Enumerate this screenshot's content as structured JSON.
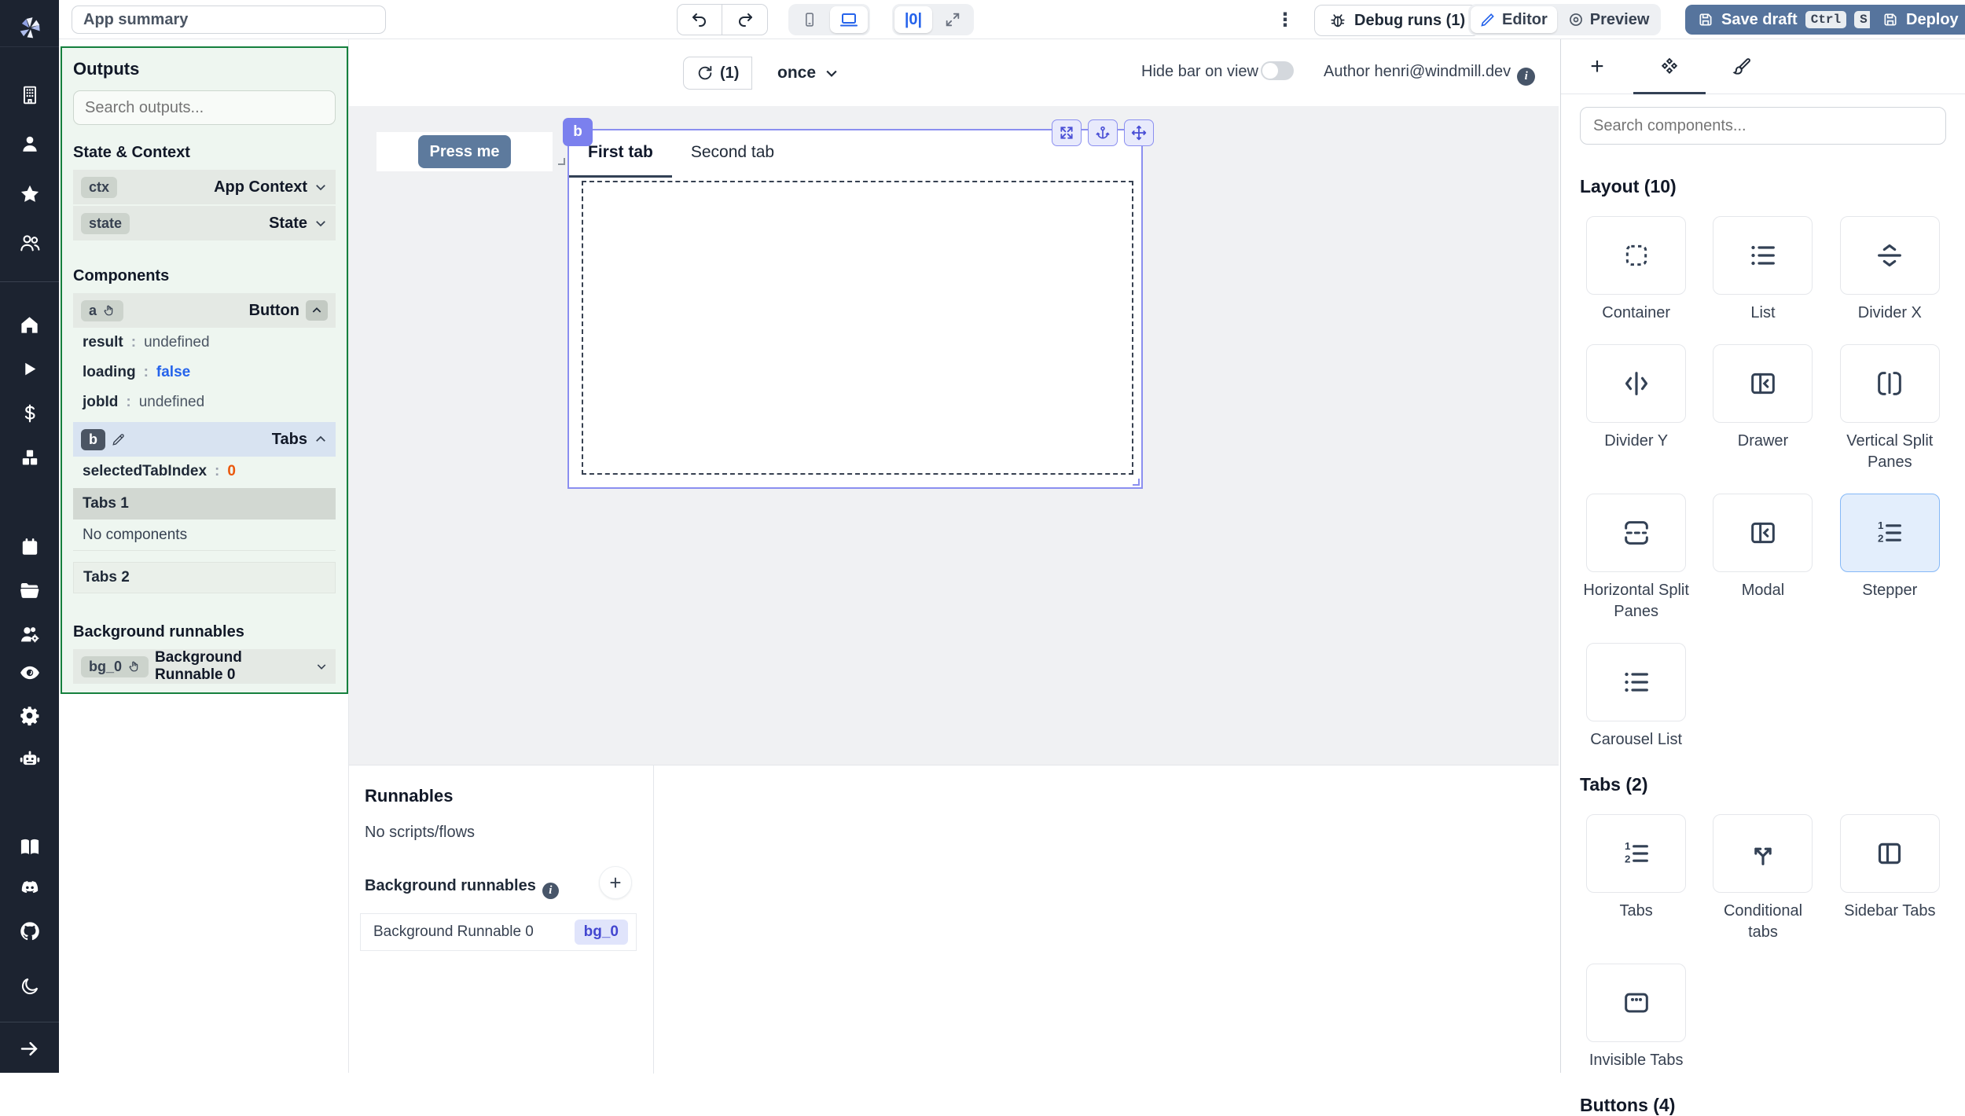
{
  "colors": {
    "sidebar_bg": "#1c2330",
    "primary_button_blue": "#56749d",
    "canvas_button_blue": "#5d7a9d",
    "selection_indigo": "#7b80ee",
    "outputs_border_green": "#15803d",
    "selected_card_bg": "#e3eefc",
    "link_blue": "#2563eb",
    "value_orange": "#ea580c"
  },
  "sidebar": {
    "icons": [
      "windmill-logo",
      "workspace-building",
      "user",
      "favorites-star",
      "groups",
      "home",
      "runs-play",
      "billing-dollar",
      "resources-boxes",
      "schedules-calendar",
      "folders",
      "workers-admin",
      "audit-eye",
      "settings-gear",
      "ai-bot",
      "docs-book",
      "discord",
      "github",
      "dark-mode-moon",
      "collapse-arrow"
    ]
  },
  "topbar": {
    "app_summary": "App summary",
    "debug_runs": "Debug runs (1)",
    "editor": "Editor",
    "preview": "Preview",
    "save_draft": "Save draft",
    "kbd_ctrl": "Ctrl",
    "kbd_s": "S",
    "deploy": "Deploy"
  },
  "outputs": {
    "title": "Outputs",
    "search_placeholder": "Search outputs...",
    "state_context": {
      "title": "State & Context",
      "rows": [
        {
          "id": "ctx",
          "type": "App Context"
        },
        {
          "id": "state",
          "type": "State"
        }
      ]
    },
    "components": {
      "title": "Components",
      "a": {
        "id": "a",
        "type": "Button",
        "props": [
          {
            "key": "result",
            "colon": ":",
            "value": "undefined"
          },
          {
            "key": "loading",
            "colon": ":",
            "value": "false"
          },
          {
            "key": "jobId",
            "colon": ":",
            "value": "undefined"
          }
        ]
      },
      "b": {
        "id": "b",
        "type": "Tabs",
        "props": [
          {
            "key": "selectedTabIndex",
            "colon": ":",
            "value": "0"
          }
        ]
      },
      "tabs1_label": "Tabs 1",
      "tabs1_empty": "No components",
      "tabs2_label": "Tabs 2"
    },
    "background": {
      "title": "Background runnables",
      "row": {
        "id": "bg_0",
        "label": "Background Runnable 0"
      }
    }
  },
  "canvas": {
    "refresh_count": "(1)",
    "schedule": "once",
    "hide_bar_label": "Hide bar on view",
    "author": "Author henri@windmill.dev",
    "button_label": "Press me",
    "component": {
      "id": "b",
      "tabs": [
        "First tab",
        "Second tab"
      ]
    }
  },
  "runnables": {
    "title": "Runnables",
    "empty": "No scripts/flows",
    "background_title": "Background runnables",
    "row_label": "Background Runnable 0",
    "row_badge": "bg_0"
  },
  "components_panel": {
    "search_placeholder": "Search components...",
    "tab_icons": [
      "plus-icon",
      "components-icon",
      "style-icon"
    ],
    "sections": [
      {
        "title": "Layout (10)",
        "items": [
          {
            "label": "Container"
          },
          {
            "label": "List"
          },
          {
            "label": "Divider X"
          },
          {
            "label": "Divider Y"
          },
          {
            "label": "Drawer"
          },
          {
            "label": "Vertical Split Panes"
          },
          {
            "label": "Horizontal Split Panes"
          },
          {
            "label": "Modal"
          },
          {
            "label": "Stepper",
            "selected": true
          },
          {
            "label": "Carousel List"
          }
        ]
      },
      {
        "title": "Tabs (2)",
        "items": [
          {
            "label": "Tabs"
          },
          {
            "label": "Conditional tabs"
          },
          {
            "label": "Sidebar Tabs"
          },
          {
            "label": "Invisible Tabs"
          }
        ]
      },
      {
        "title": "Buttons (4)",
        "items": []
      }
    ]
  }
}
